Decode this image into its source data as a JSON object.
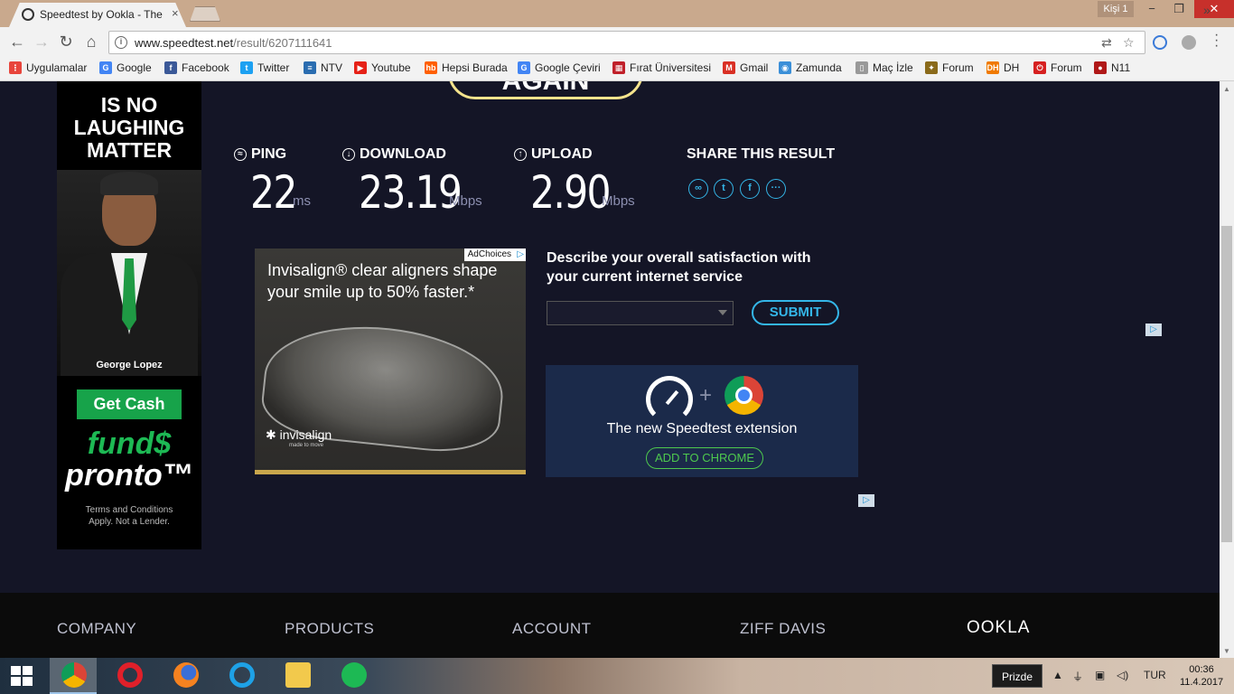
{
  "browser": {
    "tab_title": "Speedtest by Ookla - The",
    "tab_close": "×",
    "profile": "Kişi 1",
    "win_minimize": "−",
    "win_maximize": "❐",
    "win_close": "✕",
    "url_host": "www.speedtest.net",
    "url_path": "/result/6207111641",
    "back_icon": "back-arrow-icon",
    "forward_icon": "forward-arrow-icon",
    "reload_icon": "reload-icon",
    "home_icon": "home-icon"
  },
  "bookmarks": [
    {
      "label": "Uygulamalar",
      "color": "#e8453c",
      "glyph": "⋮"
    },
    {
      "label": "Google",
      "color": "#4285f4",
      "glyph": "G"
    },
    {
      "label": "Facebook",
      "color": "#3b5998",
      "glyph": "f"
    },
    {
      "label": "Twitter",
      "color": "#1da1f2",
      "glyph": "t"
    },
    {
      "label": "NTV",
      "color": "#2a6db0",
      "glyph": "≡"
    },
    {
      "label": "Youtube",
      "color": "#e62117",
      "glyph": "▶"
    },
    {
      "label": "Hepsi Burada",
      "color": "#ff6000",
      "glyph": "hb"
    },
    {
      "label": "Google Çeviri",
      "color": "#4285f4",
      "glyph": "G"
    },
    {
      "label": "Fırat Üniversitesi",
      "color": "#c0202a",
      "glyph": "▦"
    },
    {
      "label": "Gmail",
      "color": "#d93025",
      "glyph": "M"
    },
    {
      "label": "Zamunda",
      "color": "#3a8fd8",
      "glyph": "◉"
    },
    {
      "label": "Maç İzle",
      "color": "#999999",
      "glyph": "▯"
    },
    {
      "label": "Forum",
      "color": "#8a6a1a",
      "glyph": "✦"
    },
    {
      "label": "DH",
      "color": "#f07a00",
      "glyph": "DH"
    },
    {
      "label": "Forum",
      "color": "#d62020",
      "glyph": "⏻"
    },
    {
      "label": "N11",
      "color": "#b01818",
      "glyph": "●"
    }
  ],
  "bookmarks_more": "»",
  "left_ad": {
    "line1": "IS NO",
    "line2": "LAUGHING",
    "line3": "MATTER",
    "person_name": "George Lopez",
    "cta": "Get Cash",
    "brand1": "fund$",
    "brand2": "pronto™",
    "terms1": "Terms and Conditions",
    "terms2": "Apply. Not a Lender."
  },
  "again_button": "AGAIN",
  "results": {
    "ping": {
      "label": "PING",
      "value": "22",
      "unit": "ms"
    },
    "download": {
      "label": "DOWNLOAD",
      "value": "23.19",
      "unit": "Mbps"
    },
    "upload": {
      "label": "UPLOAD",
      "value": "2.90",
      "unit": "Mbps"
    }
  },
  "share": {
    "label": "SHARE THIS RESULT",
    "icons": [
      "link-icon",
      "twitter-icon",
      "facebook-icon",
      "more-icon"
    ]
  },
  "invisalign_ad": {
    "adchoices": "AdChoices",
    "headline": "Invisalign® clear aligners shape your smile up to 50% faster.*",
    "brand": "✱ invisalign",
    "tagline": "made to move"
  },
  "survey": {
    "question": "Describe your overall satisfaction with your current internet service",
    "submit": "SUBMIT"
  },
  "extension_promo": {
    "plus": "+",
    "text": "The new Speedtest extension",
    "button": "ADD TO CHROME"
  },
  "footer": {
    "columns": [
      "COMPANY",
      "PRODUCTS",
      "ACCOUNT",
      "ZIFF DAVIS"
    ],
    "logo": "OOKLA"
  },
  "taskbar": {
    "tooltip": "Prizde",
    "lang": "TUR",
    "time": "00:36",
    "date": "11.4.2017"
  }
}
